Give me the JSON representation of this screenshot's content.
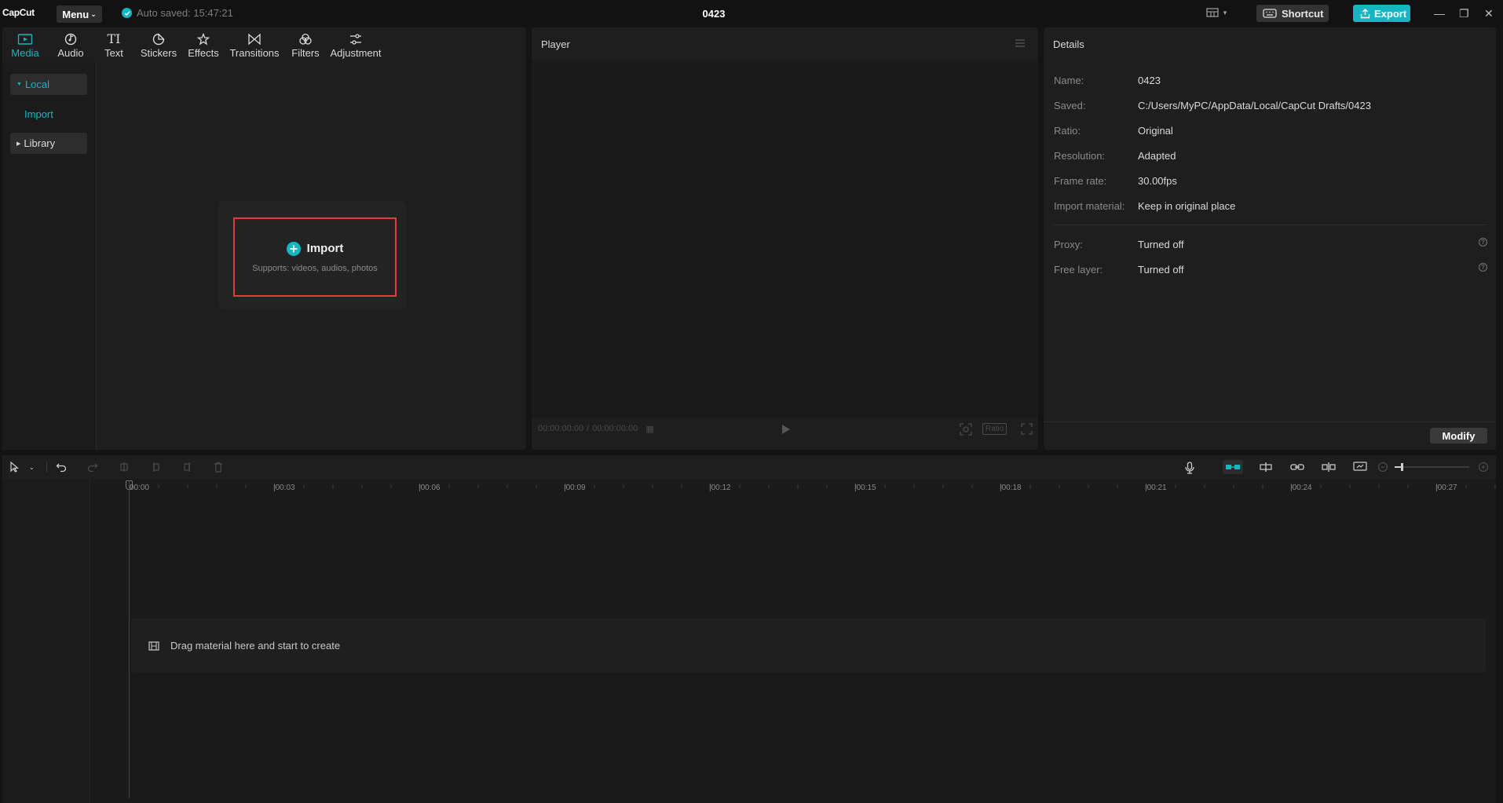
{
  "app": {
    "logo": "CapCut",
    "menu_label": "Menu",
    "autosave": "Auto saved: 15:47:21",
    "project_title": "0423",
    "shortcut_label": "Shortcut",
    "export_label": "Export"
  },
  "toolbar": {
    "tabs": [
      {
        "label": "Media",
        "icon": "media-icon",
        "active": true
      },
      {
        "label": "Audio",
        "icon": "audio-icon"
      },
      {
        "label": "Text",
        "icon": "text-icon"
      },
      {
        "label": "Stickers",
        "icon": "stickers-icon"
      },
      {
        "label": "Effects",
        "icon": "effects-icon"
      },
      {
        "label": "Transitions",
        "icon": "transitions-icon"
      },
      {
        "label": "Filters",
        "icon": "filters-icon"
      },
      {
        "label": "Adjustment",
        "icon": "adjustment-icon"
      }
    ]
  },
  "sidebar": {
    "items": [
      {
        "label": "Local",
        "expanded": true,
        "selected": true
      },
      {
        "label": "Import"
      },
      {
        "label": "Library",
        "expanded": false
      }
    ]
  },
  "import_card": {
    "title": "Import",
    "subtitle": "Supports: videos, audios, photos"
  },
  "player": {
    "title": "Player",
    "time_current": "00:00:00:00",
    "time_total": "00:00:00:00",
    "ratio_label": "Ratio"
  },
  "details": {
    "title": "Details",
    "rows": [
      {
        "label": "Name:",
        "value": "0423"
      },
      {
        "label": "Saved:",
        "value": "C:/Users/MyPC/AppData/Local/CapCut Drafts/0423"
      },
      {
        "label": "Ratio:",
        "value": "Original"
      },
      {
        "label": "Resolution:",
        "value": "Adapted"
      },
      {
        "label": "Frame rate:",
        "value": "30.00fps"
      },
      {
        "label": "Import material:",
        "value": "Keep in original place"
      }
    ],
    "rows2": [
      {
        "label": "Proxy:",
        "value": "Turned off"
      },
      {
        "label": "Free layer:",
        "value": "Turned off"
      }
    ],
    "modify_label": "Modify"
  },
  "timeline": {
    "ruler_labels": [
      "00:00",
      "|00:03",
      "|00:06",
      "|00:09",
      "|00:12",
      "|00:15",
      "|00:18",
      "|00:21",
      "|00:24",
      "|00:27"
    ],
    "drop_hint": "Drag material here and start to create"
  },
  "colors": {
    "accent": "#16b5c2",
    "highlight_border": "#e8393c",
    "panel": "#1e1e1e",
    "background": "#141414"
  }
}
